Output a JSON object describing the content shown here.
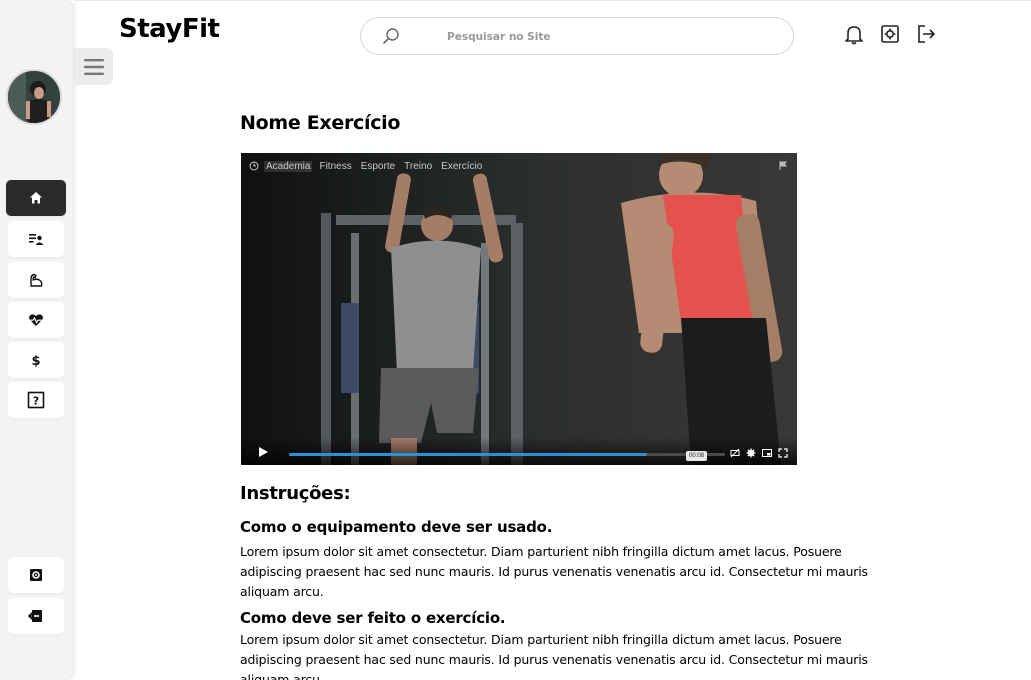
{
  "app": {
    "logo": "StayFit"
  },
  "search": {
    "placeholder": "Pesquisar no Site"
  },
  "header_icons": [
    "bell-icon",
    "settings-icon",
    "logout-icon"
  ],
  "sidebar": {
    "items": [
      {
        "id": "home",
        "icon": "home-icon",
        "active": true
      },
      {
        "id": "workouts",
        "icon": "playlist-user-icon",
        "active": false
      },
      {
        "id": "exercises",
        "icon": "muscle-arm-icon",
        "active": false
      },
      {
        "id": "health",
        "icon": "heart-pulse-icon",
        "active": false
      },
      {
        "id": "payments",
        "icon": "dollar-icon",
        "active": false
      },
      {
        "id": "help",
        "icon": "question-icon",
        "active": false
      }
    ],
    "bottom_items": [
      {
        "id": "settings",
        "icon": "gear-icon"
      },
      {
        "id": "logout",
        "icon": "exit-icon"
      }
    ]
  },
  "main": {
    "title": "Nome Exercício",
    "video": {
      "tags": [
        "Academia",
        "Fitness",
        "Esporte",
        "Treino",
        "Exercício"
      ],
      "selected_tag": "Academia",
      "time_tooltip": "00:08",
      "progress": 0.82,
      "colors": {
        "progress": "#2d8fd5"
      }
    },
    "instructions_heading": "Instruções:",
    "sections": [
      {
        "heading": "Como o equipamento deve ser usado.",
        "text": "Lorem ipsum dolor sit amet consectetur. Diam parturient nibh fringilla dictum amet lacus. Posuere adipiscing praesent hac sed nunc mauris. Id purus venenatis venenatis arcu id. Consectetur mi mauris aliquam arcu."
      },
      {
        "heading": "Como deve ser feito o exercício.",
        "text": "Lorem ipsum dolor sit amet consectetur. Diam parturient nibh fringilla dictum amet lacus. Posuere adipiscing praesent hac sed nunc mauris. Id purus venenatis venenatis arcu id. Consectetur mi mauris aliquam arcu."
      }
    ]
  }
}
